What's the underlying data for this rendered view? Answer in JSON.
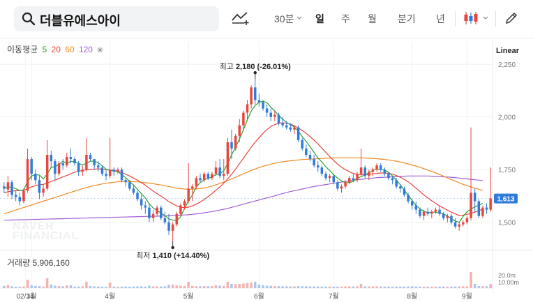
{
  "search": {
    "value": "더블유에스아이"
  },
  "toolbar": {
    "interval_label": "30분",
    "periods": [
      "일",
      "주",
      "월",
      "분기",
      "년"
    ],
    "active_period": "일",
    "icons": [
      "compare-chart-icon",
      "dropdown-chevron-icon",
      "candle-type-icon",
      "pencil-icon"
    ]
  },
  "legend": {
    "title": "이동평균",
    "ma": [
      {
        "label": "5",
        "color": "#2ca02c"
      },
      {
        "label": "20",
        "color": "#e8453c"
      },
      {
        "label": "60",
        "color": "#f08a24"
      },
      {
        "label": "120",
        "color": "#a05fd6"
      }
    ],
    "close_icon": "close-icon"
  },
  "scale_label": "Linear",
  "current_price": "1,613",
  "volume_label": "거래량 5,906,160",
  "watermark": "NAVER FINANCIAL",
  "colors": {
    "up": "#e8453c",
    "down": "#2f7bd9",
    "price_tag": "#2f7bd9"
  },
  "chart_data": {
    "type": "candlestick",
    "price_axis": {
      "ticks": [
        "2,250",
        "2,000",
        "1,750",
        "1,500"
      ],
      "ylim": [
        1380,
        2290
      ]
    },
    "volume_axis": {
      "ticks": [
        "20.0m",
        "10.00m"
      ]
    },
    "x_ticks": [
      "02/14",
      "3월",
      "4월",
      "5월",
      "6월",
      "7월",
      "8월",
      "9월"
    ],
    "annotations": {
      "high": {
        "label": "최고",
        "value": "2,180",
        "change": "(-26.01%)",
        "price": 2180
      },
      "low": {
        "label": "최저",
        "value": "1,410",
        "change": "(+14.40%)",
        "price": 1410
      }
    },
    "candles": [
      [
        1670,
        1690,
        1640,
        1660
      ],
      [
        1655,
        1720,
        1620,
        1690
      ],
      [
        1690,
        1700,
        1610,
        1630
      ],
      [
        1630,
        1650,
        1600,
        1620
      ],
      [
        1620,
        1640,
        1580,
        1600
      ],
      [
        1600,
        1660,
        1590,
        1650
      ],
      [
        1650,
        1850,
        1640,
        1800
      ],
      [
        1800,
        1810,
        1700,
        1730
      ],
      [
        1730,
        1750,
        1680,
        1700
      ],
      [
        1700,
        1720,
        1610,
        1640
      ],
      [
        1640,
        1680,
        1620,
        1660
      ],
      [
        1660,
        1890,
        1650,
        1820
      ],
      [
        1820,
        1840,
        1760,
        1790
      ],
      [
        1790,
        1800,
        1700,
        1730
      ],
      [
        1730,
        1790,
        1720,
        1780
      ],
      [
        1780,
        1800,
        1750,
        1770
      ],
      [
        1770,
        1830,
        1760,
        1810
      ],
      [
        1810,
        1850,
        1780,
        1800
      ],
      [
        1800,
        1810,
        1770,
        1780
      ],
      [
        1780,
        1790,
        1720,
        1740
      ],
      [
        1740,
        1770,
        1720,
        1750
      ],
      [
        1750,
        1900,
        1740,
        1820
      ],
      [
        1820,
        1830,
        1790,
        1800
      ],
      [
        1800,
        1800,
        1750,
        1770
      ],
      [
        1770,
        1790,
        1740,
        1760
      ],
      [
        1760,
        1770,
        1720,
        1730
      ],
      [
        1730,
        1750,
        1700,
        1720
      ],
      [
        1720,
        1900,
        1710,
        1750
      ],
      [
        1750,
        1760,
        1720,
        1740
      ],
      [
        1740,
        1760,
        1730,
        1750
      ],
      [
        1750,
        1760,
        1690,
        1700
      ],
      [
        1700,
        1710,
        1670,
        1690
      ],
      [
        1690,
        1700,
        1650,
        1660
      ],
      [
        1660,
        1680,
        1630,
        1640
      ],
      [
        1640,
        1650,
        1600,
        1610
      ],
      [
        1610,
        1630,
        1560,
        1580
      ],
      [
        1580,
        1600,
        1540,
        1570
      ],
      [
        1570,
        1590,
        1500,
        1520
      ],
      [
        1520,
        1560,
        1500,
        1540
      ],
      [
        1540,
        1580,
        1530,
        1570
      ],
      [
        1570,
        1580,
        1510,
        1520
      ],
      [
        1520,
        1550,
        1490,
        1500
      ],
      [
        1500,
        1540,
        1440,
        1460
      ],
      [
        1460,
        1500,
        1410,
        1490
      ],
      [
        1490,
        1550,
        1480,
        1540
      ],
      [
        1540,
        1590,
        1530,
        1580
      ],
      [
        1580,
        1610,
        1560,
        1600
      ],
      [
        1600,
        1780,
        1590,
        1660
      ],
      [
        1660,
        1680,
        1600,
        1670
      ],
      [
        1670,
        1720,
        1660,
        1710
      ],
      [
        1710,
        1730,
        1690,
        1700
      ],
      [
        1700,
        1740,
        1690,
        1730
      ],
      [
        1730,
        1740,
        1700,
        1710
      ],
      [
        1710,
        1740,
        1700,
        1730
      ],
      [
        1730,
        1790,
        1720,
        1760
      ],
      [
        1760,
        1800,
        1710,
        1720
      ],
      [
        1720,
        1800,
        1700,
        1730
      ],
      [
        1730,
        1900,
        1720,
        1880
      ],
      [
        1880,
        1940,
        1800,
        1850
      ],
      [
        1850,
        1920,
        1840,
        1910
      ],
      [
        1910,
        1990,
        1880,
        1960
      ],
      [
        1960,
        2030,
        1940,
        2020
      ],
      [
        2020,
        2080,
        1990,
        2060
      ],
      [
        2060,
        2150,
        2040,
        2140
      ],
      [
        2140,
        2180,
        2060,
        2080
      ],
      [
        2080,
        2110,
        2050,
        2070
      ],
      [
        2070,
        2080,
        2030,
        2040
      ],
      [
        2040,
        2060,
        2000,
        2020
      ],
      [
        2020,
        2040,
        1980,
        2000
      ],
      [
        2000,
        2030,
        1980,
        2010
      ],
      [
        2010,
        2020,
        1960,
        1970
      ],
      [
        1970,
        2000,
        1950,
        1960
      ],
      [
        1960,
        1980,
        1940,
        1950
      ],
      [
        1950,
        1970,
        1930,
        1940
      ],
      [
        1940,
        1960,
        1920,
        1950
      ],
      [
        1950,
        1960,
        1880,
        1890
      ],
      [
        1890,
        1900,
        1840,
        1850
      ],
      [
        1850,
        1870,
        1810,
        1820
      ],
      [
        1820,
        1840,
        1790,
        1800
      ],
      [
        1800,
        1820,
        1760,
        1770
      ],
      [
        1770,
        1790,
        1740,
        1760
      ],
      [
        1760,
        1770,
        1720,
        1730
      ],
      [
        1730,
        1740,
        1700,
        1710
      ],
      [
        1710,
        1730,
        1690,
        1720
      ],
      [
        1720,
        1730,
        1680,
        1690
      ],
      [
        1690,
        1700,
        1650,
        1660
      ],
      [
        1660,
        1680,
        1640,
        1670
      ],
      [
        1670,
        1700,
        1660,
        1690
      ],
      [
        1690,
        1720,
        1680,
        1710
      ],
      [
        1710,
        1730,
        1690,
        1700
      ],
      [
        1700,
        1740,
        1690,
        1730
      ],
      [
        1730,
        1850,
        1720,
        1760
      ],
      [
        1760,
        1770,
        1710,
        1720
      ],
      [
        1720,
        1750,
        1700,
        1740
      ],
      [
        1740,
        1760,
        1720,
        1750
      ],
      [
        1750,
        1780,
        1740,
        1770
      ],
      [
        1770,
        1780,
        1740,
        1750
      ],
      [
        1750,
        1760,
        1720,
        1730
      ],
      [
        1730,
        1740,
        1700,
        1710
      ],
      [
        1710,
        1720,
        1680,
        1700
      ],
      [
        1700,
        1710,
        1660,
        1670
      ],
      [
        1670,
        1680,
        1640,
        1660
      ],
      [
        1660,
        1670,
        1620,
        1630
      ],
      [
        1630,
        1640,
        1590,
        1600
      ],
      [
        1600,
        1610,
        1560,
        1580
      ],
      [
        1580,
        1600,
        1540,
        1560
      ],
      [
        1560,
        1570,
        1520,
        1530
      ],
      [
        1530,
        1560,
        1510,
        1550
      ],
      [
        1550,
        1570,
        1530,
        1540
      ],
      [
        1540,
        1560,
        1520,
        1550
      ],
      [
        1550,
        1570,
        1540,
        1560
      ],
      [
        1560,
        1580,
        1530,
        1540
      ],
      [
        1540,
        1550,
        1510,
        1520
      ],
      [
        1520,
        1540,
        1500,
        1530
      ],
      [
        1530,
        1540,
        1490,
        1500
      ],
      [
        1500,
        1520,
        1470,
        1480
      ],
      [
        1480,
        1500,
        1460,
        1490
      ],
      [
        1490,
        1510,
        1480,
        1500
      ],
      [
        1500,
        1530,
        1490,
        1520
      ],
      [
        1520,
        1950,
        1510,
        1640
      ],
      [
        1640,
        1660,
        1550,
        1600
      ],
      [
        1600,
        1610,
        1520,
        1530
      ],
      [
        1530,
        1580,
        1520,
        1570
      ],
      [
        1570,
        1590,
        1540,
        1560
      ],
      [
        1560,
        1760,
        1550,
        1613
      ]
    ],
    "ma5": [
      1660,
      1668,
      1666,
      1660,
      1650,
      1654,
      1694,
      1720,
      1726,
      1724,
      1706,
      1730,
      1760,
      1764,
      1774,
      1790,
      1778,
      1790,
      1786,
      1780,
      1772,
      1780,
      1790,
      1790,
      1782,
      1768,
      1752,
      1746,
      1744,
      1740,
      1726,
      1712,
      1694,
      1676,
      1656,
      1636,
      1616,
      1588,
      1568,
      1556,
      1544,
      1532,
      1516,
      1510,
      1508,
      1526,
      1566,
      1600,
      1630,
      1668,
      1688,
      1702,
      1708,
      1716,
      1726,
      1730,
      1744,
      1780,
      1820,
      1856,
      1896,
      1938,
      1986,
      2028,
      2054,
      2070,
      2074,
      2068,
      2046,
      2028,
      2006,
      1990,
      1974,
      1962,
      1952,
      1932,
      1906,
      1884,
      1858,
      1832,
      1806,
      1786,
      1764,
      1746,
      1726,
      1710,
      1696,
      1688,
      1688,
      1694,
      1710,
      1716,
      1726,
      1734,
      1748,
      1752,
      1752,
      1748,
      1738,
      1720,
      1700,
      1678,
      1652,
      1628,
      1604,
      1580,
      1564,
      1552,
      1546,
      1548,
      1548,
      1544,
      1540,
      1530,
      1518,
      1506,
      1500,
      1528,
      1550,
      1562,
      1574,
      1580,
      1590
    ],
    "ma20": [
      1640,
      1645,
      1648,
      1650,
      1650,
      1652,
      1660,
      1668,
      1674,
      1678,
      1680,
      1686,
      1694,
      1700,
      1708,
      1716,
      1722,
      1730,
      1738,
      1742,
      1746,
      1750,
      1752,
      1752,
      1754,
      1752,
      1750,
      1748,
      1746,
      1742,
      1736,
      1728,
      1720,
      1710,
      1700,
      1688,
      1676,
      1662,
      1648,
      1636,
      1624,
      1612,
      1598,
      1588,
      1578,
      1572,
      1570,
      1572,
      1578,
      1586,
      1596,
      1608,
      1622,
      1636,
      1652,
      1668,
      1686,
      1706,
      1728,
      1752,
      1778,
      1804,
      1830,
      1856,
      1880,
      1902,
      1922,
      1940,
      1954,
      1964,
      1970,
      1972,
      1970,
      1966,
      1958,
      1948,
      1936,
      1922,
      1906,
      1890,
      1872,
      1852,
      1832,
      1812,
      1794,
      1776,
      1762,
      1750,
      1740,
      1732,
      1728,
      1726,
      1726,
      1728,
      1730,
      1732,
      1734,
      1734,
      1732,
      1728,
      1722,
      1714,
      1704,
      1692,
      1678,
      1662,
      1646,
      1630,
      1616,
      1602,
      1590,
      1578,
      1568,
      1558,
      1548,
      1540,
      1532,
      1534,
      1538,
      1542,
      1548,
      1556,
      1562
    ],
    "ma60": [
      1540,
      1546,
      1552,
      1558,
      1564,
      1570,
      1576,
      1582,
      1588,
      1594,
      1600,
      1606,
      1612,
      1618,
      1624,
      1630,
      1636,
      1642,
      1648,
      1654,
      1660,
      1665,
      1670,
      1674,
      1678,
      1682,
      1685,
      1688,
      1690,
      1692,
      1694,
      1694,
      1694,
      1693,
      1692,
      1690,
      1688,
      1686,
      1683,
      1680,
      1677,
      1674,
      1670,
      1666,
      1662,
      1660,
      1658,
      1657,
      1657,
      1658,
      1660,
      1663,
      1667,
      1672,
      1678,
      1684,
      1691,
      1698,
      1706,
      1714,
      1722,
      1730,
      1738,
      1746,
      1753,
      1760,
      1766,
      1771,
      1776,
      1780,
      1784,
      1787,
      1790,
      1792,
      1794,
      1796,
      1798,
      1799,
      1800,
      1801,
      1802,
      1803,
      1804,
      1805,
      1806,
      1806,
      1806,
      1806,
      1806,
      1806,
      1806,
      1806,
      1805,
      1804,
      1803,
      1802,
      1800,
      1798,
      1796,
      1793,
      1790,
      1786,
      1782,
      1777,
      1772,
      1767,
      1761,
      1755,
      1748,
      1741,
      1734,
      1727,
      1719,
      1711,
      1703,
      1695,
      1687,
      1680,
      1674,
      1668,
      1662,
      1657,
      1652
    ],
    "ma120": [
      1510,
      1510,
      1511,
      1511,
      1512,
      1512,
      1513,
      1513,
      1514,
      1514,
      1515,
      1515,
      1516,
      1516,
      1517,
      1517,
      1518,
      1518,
      1519,
      1519,
      1520,
      1520,
      1521,
      1521,
      1522,
      1522,
      1523,
      1523,
      1524,
      1524,
      1525,
      1525,
      1526,
      1526,
      1527,
      1527,
      1528,
      1528,
      1529,
      1529,
      1530,
      1530,
      1531,
      1532,
      1533,
      1534,
      1535,
      1536,
      1538,
      1540,
      1542,
      1545,
      1548,
      1551,
      1554,
      1558,
      1562,
      1566,
      1571,
      1576,
      1581,
      1586,
      1591,
      1596,
      1601,
      1606,
      1611,
      1616,
      1621,
      1626,
      1631,
      1636,
      1641,
      1646,
      1650,
      1654,
      1658,
      1662,
      1666,
      1670,
      1673,
      1676,
      1679,
      1682,
      1685,
      1688,
      1691,
      1694,
      1697,
      1700,
      1702,
      1704,
      1706,
      1708,
      1710,
      1712,
      1713,
      1714,
      1715,
      1716,
      1717,
      1718,
      1719,
      1720,
      1720,
      1720,
      1720,
      1720,
      1720,
      1719,
      1718,
      1717,
      1716,
      1715,
      1714,
      1712,
      1710,
      1708,
      1706,
      1704,
      1702,
      1700,
      1698
    ],
    "volume": [
      3.2,
      4.1,
      2.5,
      2,
      1.8,
      2.4,
      12,
      4,
      3,
      2.8,
      2.2,
      14,
      5,
      3.5,
      3,
      2.6,
      4,
      3.8,
      2,
      2.2,
      2.5,
      9,
      3,
      2.4,
      2.2,
      2,
      1.9,
      8,
      2.1,
      2,
      2.2,
      2.1,
      2,
      2.3,
      2.4,
      2.6,
      2.2,
      3.5,
      2.4,
      2.2,
      2.3,
      2.5,
      4.5,
      5,
      3.8,
      3.5,
      3,
      9,
      3.2,
      2.8,
      2.6,
      3,
      2.7,
      3,
      4,
      3.5,
      3.2,
      9,
      6,
      5.5,
      6,
      6.5,
      7,
      8,
      9,
      5,
      4,
      3.5,
      3.2,
      3,
      2.8,
      2.6,
      2.5,
      2.4,
      2.5,
      3,
      2.8,
      2.6,
      2.4,
      2.4,
      2.3,
      2.2,
      2.1,
      2.2,
      2.1,
      2,
      2.2,
      2.3,
      2.5,
      2.3,
      2.6,
      6,
      2.5,
      2.4,
      2.3,
      2.5,
      2.2,
      2.1,
      2,
      2,
      2.1,
      2,
      2.2,
      2.3,
      2.5,
      2.4,
      2.2,
      2.1,
      2,
      2.1,
      2,
      2.1,
      2.2,
      2,
      2.1,
      2.2,
      2.3,
      2.6,
      2.4,
      23,
      6,
      3,
      2.8,
      2.5,
      5.9
    ]
  }
}
